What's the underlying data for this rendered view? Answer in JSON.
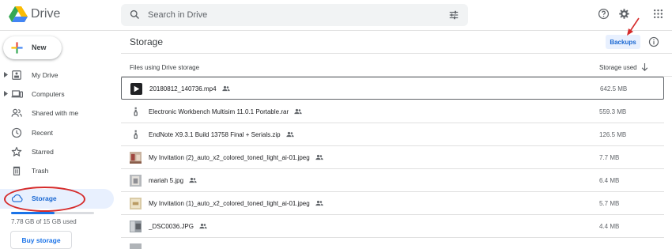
{
  "header": {
    "app_name": "Drive",
    "search_placeholder": "Search in Drive",
    "icons": [
      "drive-logo-icon",
      "search-icon",
      "tune-icon",
      "help-icon",
      "settings-icon",
      "apps-grid-icon"
    ]
  },
  "sidebar": {
    "new_label": "New",
    "items": [
      {
        "label": "My Drive",
        "icon": "my-drive-icon"
      },
      {
        "label": "Computers",
        "icon": "computer-icon"
      },
      {
        "label": "Shared with me",
        "icon": "people-icon"
      },
      {
        "label": "Recent",
        "icon": "clock-icon"
      },
      {
        "label": "Starred",
        "icon": "star-icon"
      },
      {
        "label": "Trash",
        "icon": "trash-icon"
      },
      {
        "label": "Storage",
        "icon": "cloud-icon",
        "active": true
      }
    ],
    "quota_text": "7.78 GB of 15 GB used",
    "quota_fraction": 0.52,
    "buy_storage_label": "Buy storage"
  },
  "main": {
    "title": "Storage",
    "backups_label": "Backups",
    "col_files": "Files using Drive storage",
    "col_storage": "Storage used",
    "files": [
      {
        "name": "20180812_140736.mp4",
        "size": "642.5 MB",
        "kind": "video"
      },
      {
        "name": "Electronic Workbench Multisim 11.0.1 Portable.rar",
        "size": "559.3 MB",
        "kind": "archive"
      },
      {
        "name": "EndNote X9.3.1 Build 13758 Final + Serials.zip",
        "size": "126.5 MB",
        "kind": "archive"
      },
      {
        "name": "My Invitation (2)_auto_x2_colored_toned_light_ai-01.jpeg",
        "size": "7.7 MB",
        "kind": "image"
      },
      {
        "name": "mariah 5.jpg",
        "size": "6.4 MB",
        "kind": "image"
      },
      {
        "name": "My Invitation (1)_auto_x2_colored_toned_light_ai-01.jpeg",
        "size": "5.7 MB",
        "kind": "image"
      },
      {
        "name": "_DSC0036.JPG",
        "size": "4.4 MB",
        "kind": "image"
      }
    ]
  },
  "colors": {
    "accent": "#1a73e8",
    "active_bg": "#e8f0fe",
    "annotation": "#d52b2b"
  }
}
